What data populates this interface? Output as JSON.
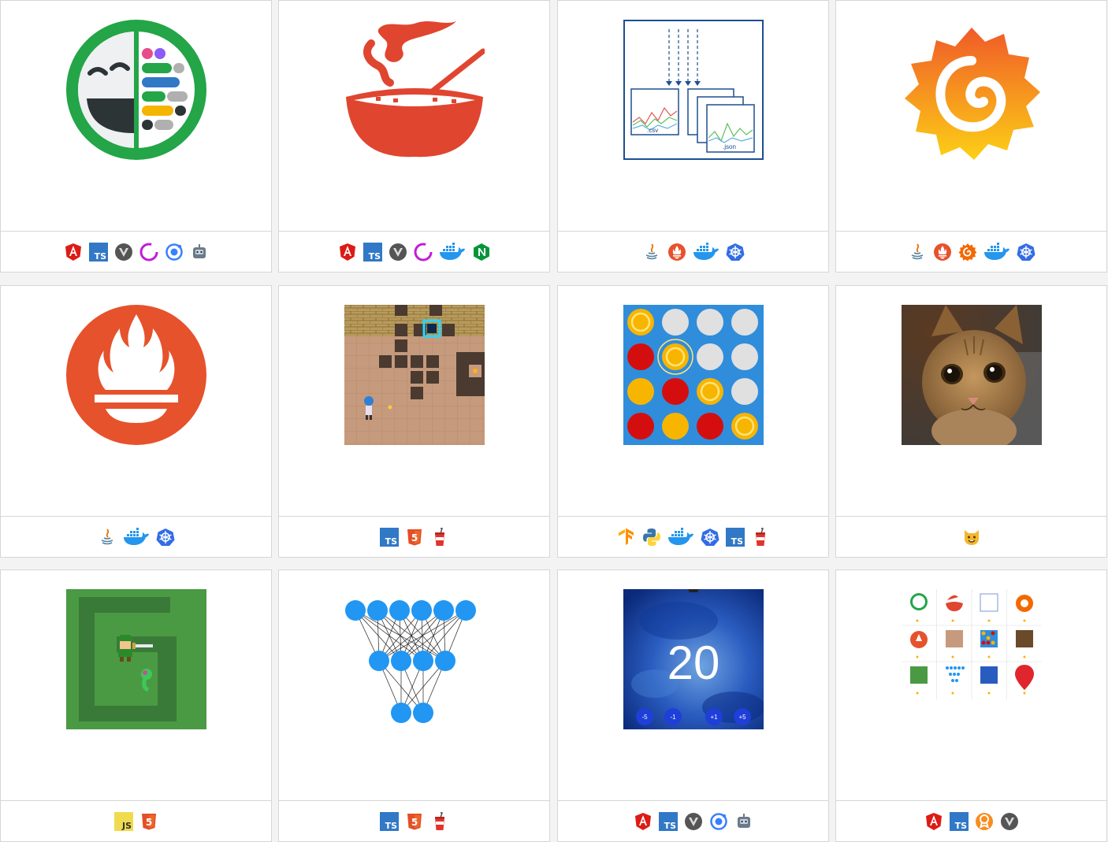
{
  "colors": {
    "angular": "#dd1b16",
    "typescript": "#3178c6",
    "javascript": "#f0db4f",
    "html5": "#e34f26",
    "java": "#e76f00",
    "prometheus": "#e6522c",
    "grafana": "#f46800",
    "docker": "#2496ed",
    "kubernetes": "#326ce5",
    "nginx": "#009639",
    "ionic": "#3880ff",
    "card_border": "#d6d6d6",
    "page_bg": "#f3f3f3"
  },
  "cards": [
    {
      "image": "gitmoji-face-logo",
      "tech": [
        "angular-icon",
        "typescript-icon",
        "vite-icon",
        "prettier-icon",
        "ionic-icon",
        "robot-icon"
      ]
    },
    {
      "image": "soup-bowl-logo",
      "tech": [
        "angular-icon",
        "typescript-icon",
        "vite-icon",
        "prettier-icon",
        "docker-icon",
        "nginx-icon"
      ]
    },
    {
      "image": "csv-json-diagram",
      "labels": {
        "csv": ".csv",
        "json": ".json"
      },
      "tech": [
        "java-icon",
        "prometheus-icon",
        "docker-icon",
        "kubernetes-icon"
      ]
    },
    {
      "image": "grafana-logo",
      "tech": [
        "java-icon",
        "prometheus-icon",
        "grafana-icon",
        "docker-icon",
        "kubernetes-icon"
      ]
    },
    {
      "image": "prometheus-logo",
      "tech": [
        "java-icon",
        "docker-icon",
        "kubernetes-icon"
      ]
    },
    {
      "image": "dungeon-game-thumb",
      "tech": [
        "typescript-icon",
        "html5-icon",
        "drink-cup-icon"
      ]
    },
    {
      "image": "connect-four-thumb",
      "tech": [
        "tensorflow-icon",
        "python-icon",
        "docker-icon",
        "kubernetes-icon",
        "typescript-icon",
        "drink-cup-icon"
      ]
    },
    {
      "image": "cat-photo",
      "tech": [
        "cat-emoji-icon"
      ]
    },
    {
      "image": "zelda-game-thumb",
      "tech": [
        "javascript-icon",
        "html5-icon"
      ]
    },
    {
      "image": "neural-network-diagram",
      "tech": [
        "typescript-icon",
        "html5-icon",
        "drink-cup-icon"
      ]
    },
    {
      "image": "counter-app-thumb",
      "counter": {
        "value": "20",
        "buttons": [
          "-5",
          "-1",
          "+1",
          "+5"
        ]
      },
      "tech": [
        "angular-icon",
        "typescript-icon",
        "vite-icon",
        "ionic-icon",
        "robot-icon"
      ]
    },
    {
      "image": "portfolio-grid-thumb",
      "tech": [
        "angular-icon",
        "typescript-icon",
        "ribbon-icon",
        "vite-icon"
      ]
    }
  ],
  "tech_labels": {
    "typescript": "TS",
    "javascript": "JS",
    "html5": "5"
  }
}
